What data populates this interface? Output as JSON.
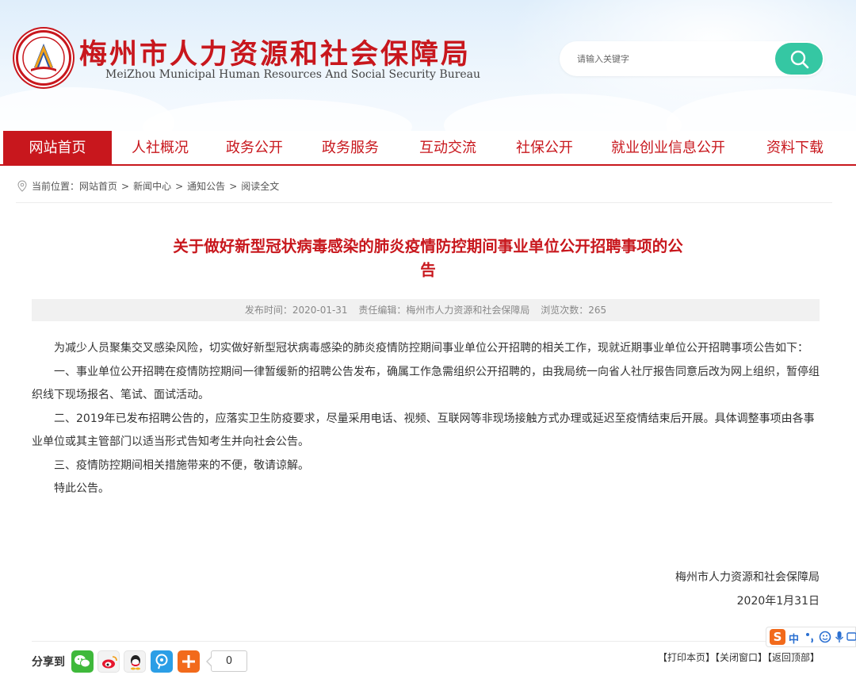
{
  "header": {
    "title": "梅州市人力资源和社会保障局",
    "subtitle": "MeiZhou Municipal Human Resources And Social Security Bureau",
    "search_placeholder": "请输入关键字"
  },
  "nav": {
    "items": [
      {
        "label": "网站首页",
        "active": true
      },
      {
        "label": "人社概况"
      },
      {
        "label": "政务公开"
      },
      {
        "label": "政务服务"
      },
      {
        "label": "互动交流"
      },
      {
        "label": "社保公开"
      },
      {
        "label": "就业创业信息公开"
      },
      {
        "label": "资料下载"
      }
    ]
  },
  "breadcrumb": {
    "prefix": "当前位置：",
    "items": [
      "网站首页",
      "新闻中心",
      "通知公告",
      "阅读全文"
    ],
    "separator": ">"
  },
  "article": {
    "title_line1": "关于做好新型冠状病毒感染的肺炎疫情防控期间事业单位公开招聘事项的公",
    "title_line2": "告",
    "meta": {
      "published": "发布时间：2020-01-31",
      "editor": "责任编辑：梅州市人力资源和社会保障局",
      "views": "浏览次数：265"
    },
    "paragraphs": [
      "为减少人员聚集交叉感染风险，切实做好新型冠状病毒感染的肺炎疫情防控期间事业单位公开招聘的相关工作，现就近期事业单位公开招聘事项公告如下：",
      "一、事业单位公开招聘在疫情防控期间一律暂缓新的招聘公告发布，确属工作急需组织公开招聘的，由我局统一向省人社厅报告同意后改为网上组织，暂停组织线下现场报名、笔试、面试活动。",
      "二、2019年已发布招聘公告的，应落实卫生防疫要求，尽量采用电话、视频、互联网等非现场接触方式办理或延迟至疫情结束后开展。具体调整事项由各事业单位或其主管部门以适当形式告知考生并向社会公告。",
      "三、疫情防控期间相关措施带来的不便，敬请谅解。",
      "特此公告。"
    ],
    "signature_org": "梅州市人力资源和社会保障局",
    "signature_date": "2020年1月31日"
  },
  "footer": {
    "share_label": "分享到",
    "share_count": "0",
    "links": [
      "【打印本页】",
      "【关闭窗口】",
      "【返回顶部】"
    ]
  },
  "ime": {
    "lang": "中"
  },
  "colors": {
    "brand_red": "#c8171d",
    "search_green": "#35c7a3"
  }
}
